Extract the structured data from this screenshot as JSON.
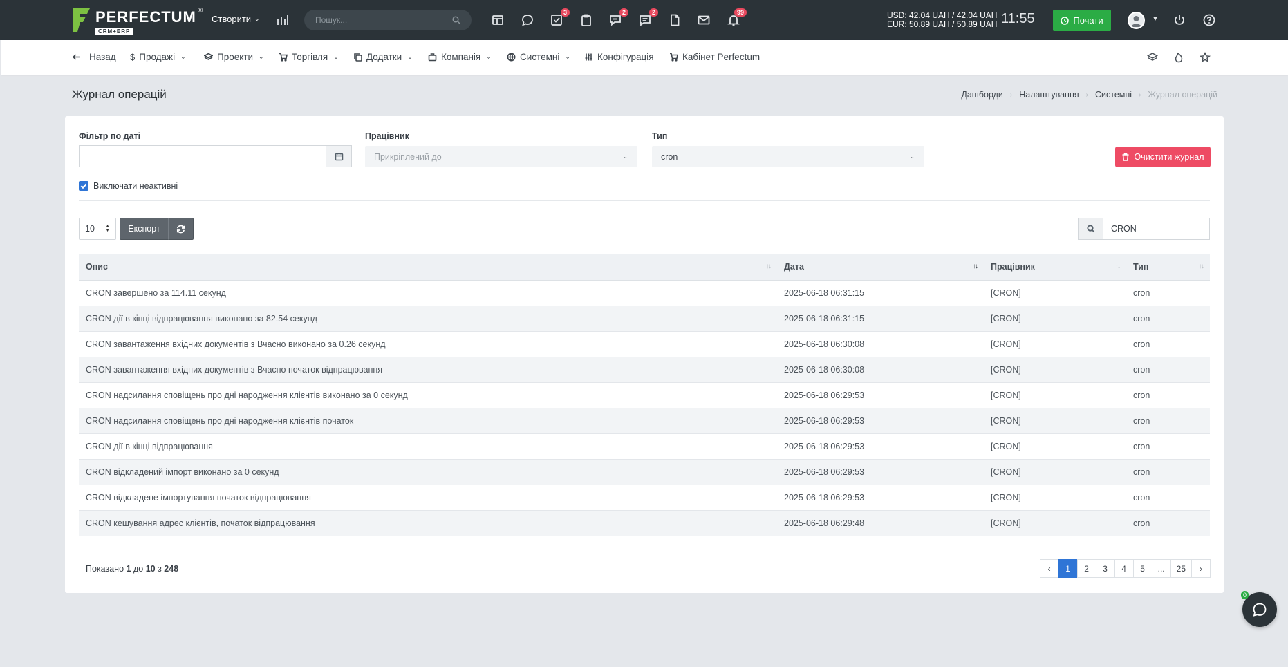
{
  "brand": {
    "name": "PERFECTUM",
    "sub": "CRM+ERP",
    "reg": "®"
  },
  "topbar": {
    "create_label": "Створити",
    "search_placeholder": "Пошук...",
    "badges": {
      "tasks": "3",
      "discussions": "2",
      "chat": "2",
      "notifications": "99"
    },
    "currency_usd": "USD: 42.04 UAH / 42.04 UAH",
    "currency_eur": "EUR: 50.89 UAH / 50.89 UAH",
    "clock": "11:55",
    "start_label": "Почати"
  },
  "nav": {
    "back": "Назад",
    "sales": "Продажі",
    "projects": "Проекти",
    "trade": "Торгівля",
    "addons": "Додатки",
    "company": "Компанія",
    "system": "Системні",
    "config": "Конфігурація",
    "cabinet": "Кабінет Perfectum"
  },
  "page": {
    "title": "Журнал операцій",
    "breadcrumb": [
      "Дашборди",
      "Налаштування",
      "Системні",
      "Журнал операцій"
    ]
  },
  "filters": {
    "date_label": "Фільтр по даті",
    "date_value": "",
    "employee_label": "Працівник",
    "employee_placeholder": "Прикріплений до",
    "type_label": "Тип",
    "type_value": "cron",
    "clear_label": "Очистити журнал",
    "exclude_inactive_label": "Виключати неактивні",
    "exclude_inactive_checked": true
  },
  "toolbar": {
    "page_length": "10",
    "export_label": "Експорт",
    "search_value": "CRON"
  },
  "table": {
    "headers": {
      "desc": "Опис",
      "date": "Дата",
      "employee": "Працівник",
      "type": "Тип"
    },
    "rows": [
      {
        "desc": "CRON завершено за 114.11 секунд",
        "date": "2025-06-18 06:31:15",
        "employee": "[CRON]",
        "type": "cron"
      },
      {
        "desc": "CRON дії в кінці відпрацювання виконано за 82.54 секунд",
        "date": "2025-06-18 06:31:15",
        "employee": "[CRON]",
        "type": "cron"
      },
      {
        "desc": "CRON завантаження вхідних документів з Вчасно виконано за 0.26 секунд",
        "date": "2025-06-18 06:30:08",
        "employee": "[CRON]",
        "type": "cron"
      },
      {
        "desc": "CRON завантаження вхідних документів з Вчасно початок відпрацювання",
        "date": "2025-06-18 06:30:08",
        "employee": "[CRON]",
        "type": "cron"
      },
      {
        "desc": "CRON надсилання сповіщень про дні народження клієнтів виконано за 0 секунд",
        "date": "2025-06-18 06:29:53",
        "employee": "[CRON]",
        "type": "cron"
      },
      {
        "desc": "CRON надсилання сповіщень про дні народження клієнтів початок",
        "date": "2025-06-18 06:29:53",
        "employee": "[CRON]",
        "type": "cron"
      },
      {
        "desc": "CRON дії в кінці відпрацювання",
        "date": "2025-06-18 06:29:53",
        "employee": "[CRON]",
        "type": "cron"
      },
      {
        "desc": "CRON відкладений імпорт виконано за 0 секунд",
        "date": "2025-06-18 06:29:53",
        "employee": "[CRON]",
        "type": "cron"
      },
      {
        "desc": "CRON відкладене імпортування початок відпрацювання",
        "date": "2025-06-18 06:29:53",
        "employee": "[CRON]",
        "type": "cron"
      },
      {
        "desc": "CRON кешування адрес клієнтів, початок відпрацювання",
        "date": "2025-06-18 06:29:48",
        "employee": "[CRON]",
        "type": "cron"
      }
    ]
  },
  "pagination": {
    "info_prefix": "Показано",
    "info_from": "1",
    "info_mid1": "до",
    "info_to": "10",
    "info_mid2": "з",
    "info_total": "248",
    "pages": [
      "1",
      "2",
      "3",
      "4",
      "5",
      "...",
      "25"
    ],
    "active_page": "1"
  },
  "chat": {
    "badge": "0"
  },
  "colors": {
    "primary": "#2f75d6",
    "danger": "#ee4b64",
    "success": "#2bac45",
    "topbar": "#2b3338"
  }
}
